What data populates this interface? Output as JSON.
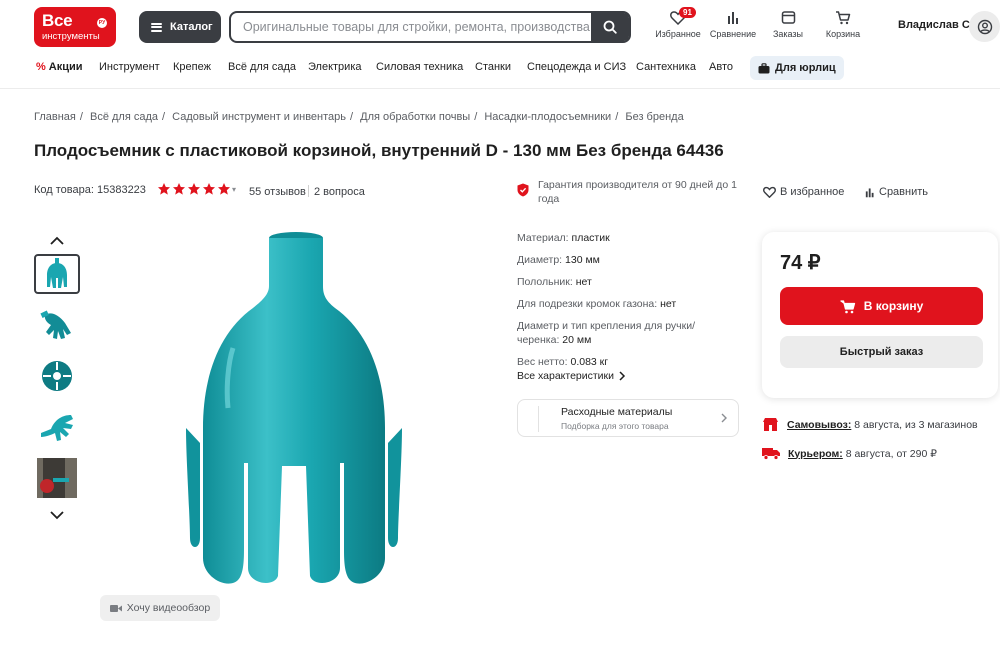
{
  "header": {
    "logo_line1": "Все",
    "logo_line2": "инструменты",
    "logo_badge": "РУ",
    "catalog_label": "Каталог",
    "search_placeholder": "Оригинальные товары для стройки, ремонта, производства",
    "favorites_label": "Избранное",
    "favorites_count": "91",
    "compare_label": "Сравнение",
    "orders_label": "Заказы",
    "cart_label": "Корзина",
    "user_name": "Владислав С.",
    "icons": [
      "hamburger-icon",
      "search-icon",
      "heart-icon",
      "bar-chart-icon",
      "orders-icon",
      "cart-icon",
      "user-icon"
    ]
  },
  "nav": {
    "sale_label": "Акции",
    "items": [
      "Инструмент",
      "Крепеж",
      "Всё для сада",
      "Электрика",
      "Силовая техника",
      "Станки",
      "Спецодежда и СИЗ",
      "Сантехника",
      "Авто"
    ],
    "business_label": "Для юрлиц"
  },
  "breadcrumbs": [
    "Главная",
    "Всё для сада",
    "Садовый инструмент и инвентарь",
    "Для обработки почвы",
    "Насадки-плодосъемники",
    "Без бренда"
  ],
  "product": {
    "title": "Плодосъемник с пластиковой корзиной, внутренний D - 130 мм Без бренда 64436",
    "code_label": "Код товара: 15383223",
    "rating": 5,
    "reviews": "55 отзывов",
    "questions": "2 вопроса",
    "guarantee": "Гарантия производителя от 90 дней до 1 года",
    "favorite_label": "В избранное",
    "compare_label": "Сравнить",
    "video_label": "Хочу видеообзор",
    "color": "#1aa6b0"
  },
  "specs": [
    {
      "label": "Материал:",
      "value": "пластик"
    },
    {
      "label": "Диаметр:",
      "value": "130 мм"
    },
    {
      "label": "Полольник:",
      "value": "нет"
    },
    {
      "label": "Для подрезки кромок газона:",
      "value": "нет"
    },
    {
      "label": "Диаметр и тип крепления для ручки/черенка:",
      "value": "20 мм"
    },
    {
      "label": "Вес нетто:",
      "value": "0.083 кг"
    }
  ],
  "all_specs_label": "Все характеристики",
  "consumables": {
    "title": "Расходные материалы",
    "subtitle": "Подборка для этого товара"
  },
  "buy": {
    "price": "74 ₽",
    "cart_button": "В корзину",
    "quick_order": "Быстрый заказ",
    "accent": "#e0131d"
  },
  "delivery": {
    "pickup_label": "Самовывоз:",
    "pickup_text": "8 августа, из 3 магазинов",
    "courier_label": "Курьером:",
    "courier_text": "8 августа, от 290 ₽"
  }
}
